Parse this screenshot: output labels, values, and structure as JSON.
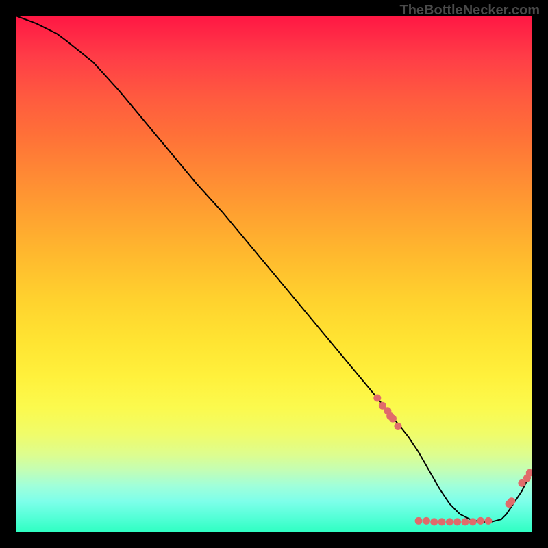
{
  "watermark": "TheBottleNecker.com",
  "chart_data": {
    "type": "line",
    "title": "",
    "xlabel": "",
    "ylabel": "",
    "xlim": [
      0,
      100
    ],
    "ylim": [
      0,
      100
    ],
    "series": [
      {
        "name": "curve",
        "x": [
          0,
          4,
          8,
          10,
          15,
          20,
          25,
          30,
          35,
          40,
          45,
          50,
          55,
          60,
          65,
          70,
          72,
          74,
          76,
          78,
          80,
          82,
          84,
          86,
          88,
          90,
          92,
          94,
          95,
          96,
          98,
          100
        ],
        "y": [
          100,
          98.5,
          96.5,
          95,
          91,
          85.5,
          79.5,
          73.5,
          67.5,
          62,
          56,
          50,
          44,
          38,
          32,
          26,
          23.5,
          21,
          18.5,
          15.5,
          12,
          8.5,
          5.5,
          3.5,
          2.5,
          2,
          2,
          2.5,
          3.5,
          5,
          8,
          12
        ]
      }
    ],
    "data_points": [
      {
        "x": 70,
        "y": 26
      },
      {
        "x": 71,
        "y": 24.5
      },
      {
        "x": 72,
        "y": 23.5
      },
      {
        "x": 72.5,
        "y": 22.5
      },
      {
        "x": 73,
        "y": 22
      },
      {
        "x": 74,
        "y": 20.5
      },
      {
        "x": 78,
        "y": 2.2
      },
      {
        "x": 79.5,
        "y": 2.2
      },
      {
        "x": 81,
        "y": 2
      },
      {
        "x": 82.5,
        "y": 2
      },
      {
        "x": 84,
        "y": 2
      },
      {
        "x": 85.5,
        "y": 2
      },
      {
        "x": 87,
        "y": 2
      },
      {
        "x": 88.5,
        "y": 2
      },
      {
        "x": 90,
        "y": 2.2
      },
      {
        "x": 91.5,
        "y": 2.2
      },
      {
        "x": 95.5,
        "y": 5.5
      },
      {
        "x": 96,
        "y": 6
      },
      {
        "x": 98,
        "y": 9.5
      },
      {
        "x": 99,
        "y": 10.5
      },
      {
        "x": 99.5,
        "y": 11.5
      }
    ]
  }
}
